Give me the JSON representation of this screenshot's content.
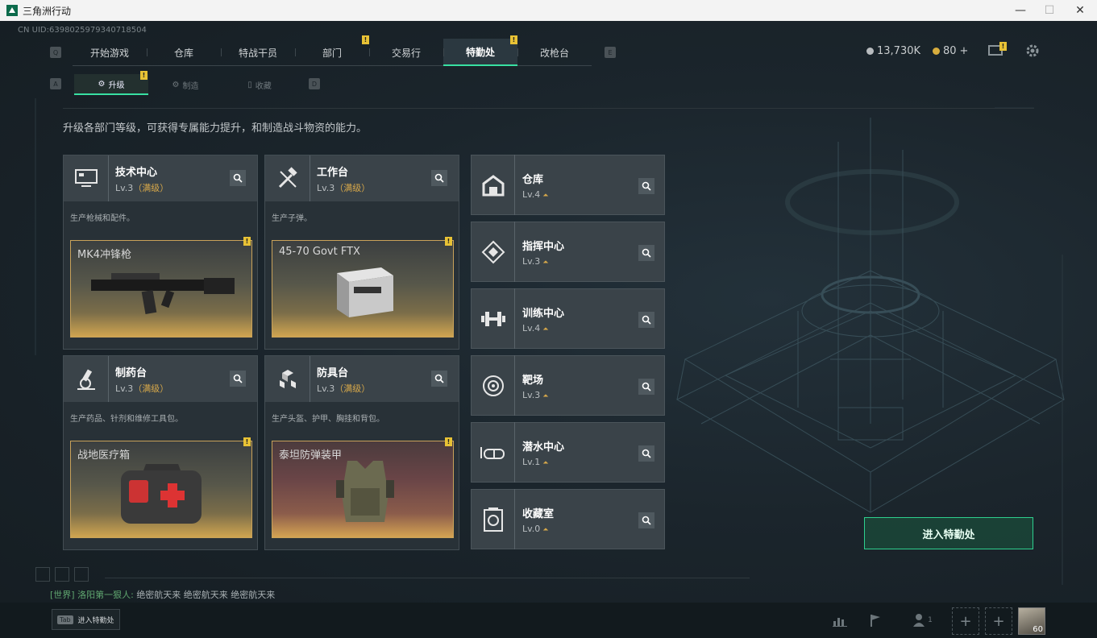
{
  "window": {
    "title": "三角洲行动",
    "minimize": "—",
    "maximize": "☐",
    "close": "✕"
  },
  "uid": "CN UID:6398025979340718504",
  "nav": {
    "left_key": "Q",
    "right_key": "E",
    "tabs": [
      "开始游戏",
      "仓库",
      "特战干员",
      "部门",
      "交易行",
      "特勤处",
      "改枪台"
    ],
    "active": "特勤处",
    "badge_mark": "!"
  },
  "currency": {
    "silver": "13,730K",
    "gold": "80",
    "gold_plus": "+"
  },
  "subtabs": {
    "left_key": "A",
    "right_key": "D",
    "items": [
      "升级",
      "制造",
      "收藏"
    ],
    "active": "升级"
  },
  "description": "升级各部门等级，可获得专属能力提升，和制造战斗物资的能力。",
  "large_cards": [
    {
      "title": "技术中心",
      "level": "Lv.3",
      "max": "（满级）",
      "desc": "生产枪械和配件。",
      "item": "MK4冲锋枪",
      "icon": "monitor-icon"
    },
    {
      "title": "工作台",
      "level": "Lv.3",
      "max": "（满级）",
      "desc": "生产子弹。",
      "item": "45-70 Govt FTX",
      "icon": "tools-icon"
    },
    {
      "title": "制药台",
      "level": "Lv.3",
      "max": "（满级）",
      "desc": "生产药品、针剂和维修工具包。",
      "item": "战地医疗箱",
      "icon": "microscope-icon"
    },
    {
      "title": "防具台",
      "level": "Lv.3",
      "max": "（满级）",
      "desc": "生产头盔、护甲、胸挂和背包。",
      "item": "泰坦防弹装甲",
      "icon": "cubes-icon"
    }
  ],
  "small_cards": [
    {
      "title": "仓库",
      "level": "Lv.4",
      "icon": "warehouse-icon"
    },
    {
      "title": "指挥中心",
      "level": "Lv.3",
      "icon": "command-icon"
    },
    {
      "title": "训练中心",
      "level": "Lv.4",
      "icon": "dumbbell-icon"
    },
    {
      "title": "靶场",
      "level": "Lv.3",
      "icon": "target-icon"
    },
    {
      "title": "潜水中心",
      "level": "Lv.1",
      "icon": "goggles-icon"
    },
    {
      "title": "收藏室",
      "level": "Lv.0",
      "icon": "collection-icon"
    }
  ],
  "enter_button": "进入特勤处",
  "chat": {
    "channel": "[世界]",
    "sender": "洛阳第一狠人:",
    "message": "绝密航天来 绝密航天来 绝密航天来"
  },
  "bottom": {
    "tab_key": "Tab",
    "tab_label": "进入特勤处",
    "friends_count": "1",
    "avatar_label": "60"
  },
  "colors": {
    "accent": "#38e0a2",
    "badge": "#e8c235",
    "max_level": "#d7a84a"
  }
}
